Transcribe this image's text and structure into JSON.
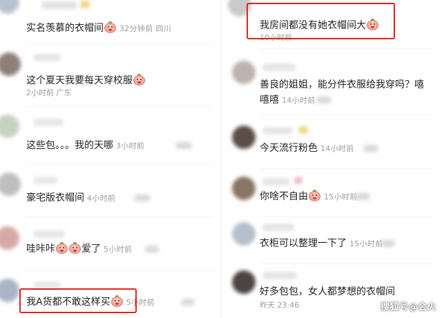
{
  "left_comments": [
    {
      "text": "实名羡慕的衣帽间",
      "emoji": true,
      "time": "32分钟前",
      "location": "四川"
    },
    {
      "text": "这个夏天我要每天穿校服",
      "emoji": true,
      "time": "2小时前",
      "location": "广东"
    },
    {
      "text": "这些包。。。我的天哪",
      "emoji": false,
      "time": "3小时前",
      "location": ""
    },
    {
      "text": "豪宅版衣帽间",
      "emoji": false,
      "time": "4小时前",
      "location": ""
    },
    {
      "text": "哇咔咔",
      "emoji_after_text": 2,
      "suffix": "爱了",
      "time": "5小时前",
      "location": ""
    },
    {
      "text": "我A货都不敢这样买",
      "emoji": true,
      "time": "5小时前",
      "location": "",
      "highlighted": true
    }
  ],
  "right_comments": [
    {
      "text": "我房间都没有她衣帽间大",
      "emoji": true,
      "time": "10小时前",
      "location": "",
      "highlighted": true
    },
    {
      "text_line1": "善良的姐姐，能分件衣服给我穿吗？嘻",
      "text_line2": "嘻嘻",
      "time": "14小时前",
      "location": ""
    },
    {
      "text": "今天流行粉色",
      "emoji": false,
      "time": "14小时前",
      "location": ""
    },
    {
      "text": "你啥不自由",
      "emoji": true,
      "time": "15小时前",
      "location": ""
    },
    {
      "text": "衣柜可以整理一下了",
      "emoji": false,
      "time": "15小时前",
      "location": ""
    },
    {
      "text": "好多包包，女人都梦想的衣帽间",
      "emoji": false,
      "time": "昨天 23:46",
      "location": ""
    }
  ],
  "watermark": "搜狐号@会火",
  "colors": {
    "highlight": "#e0221b",
    "meta": "#9a9a9a",
    "emoji_face": "#f2a396"
  }
}
